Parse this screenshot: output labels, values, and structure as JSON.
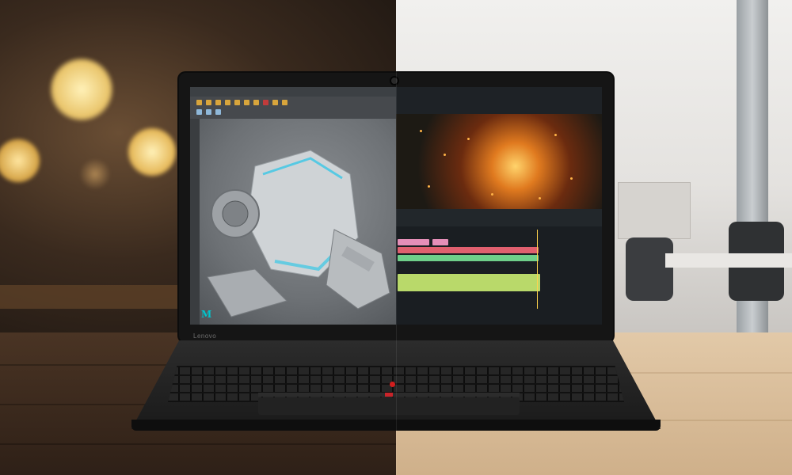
{
  "scene": {
    "description_hidden": "",
    "laptop": {
      "brand_label": "Lenovo",
      "app_left_logo": "M"
    }
  },
  "colors": {
    "accent_trackpoint": "#d21e1e",
    "left_ambient": "#6a4e34",
    "right_ambient": "#f1f0ee"
  },
  "icons": [
    "maya-logo-icon",
    "camera-icon",
    "trackpoint-icon"
  ]
}
